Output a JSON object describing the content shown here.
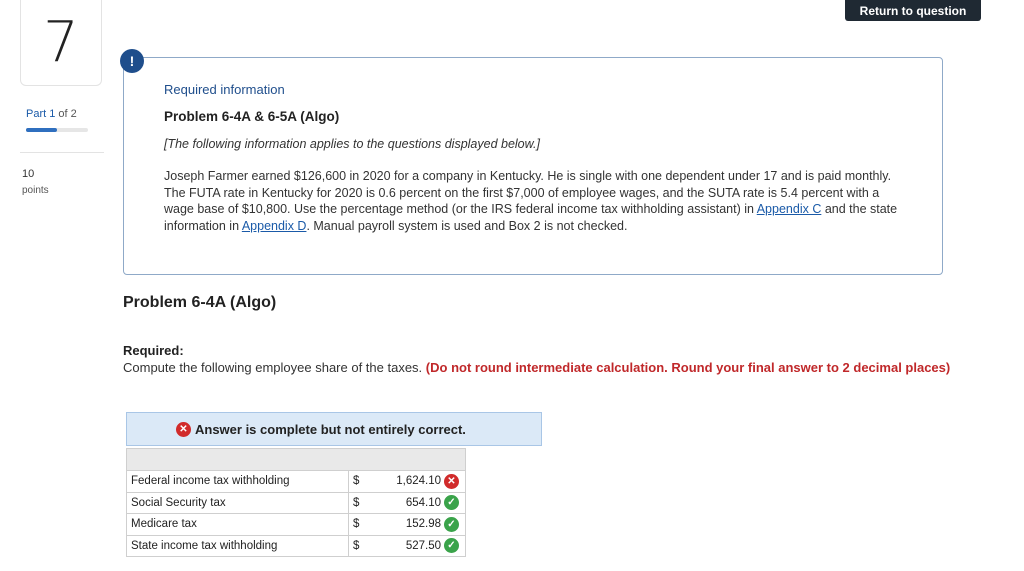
{
  "header": {
    "return_label": "Return to question"
  },
  "question": {
    "number": "7",
    "part_current": "Part 1",
    "part_total": " of 2",
    "progress": 0.5,
    "points_value": "10",
    "points_label": "points"
  },
  "info": {
    "alert_glyph": "!",
    "title": "Required information",
    "problem": "Problem 6-4A & 6-5A (Algo)",
    "note": "[The following information applies to the questions displayed below.]",
    "body_1": "Joseph Farmer earned $126,600 in 2020 for a company in Kentucky. He is single with one dependent under 17 and is paid monthly. The FUTA rate in Kentucky for 2020 is 0.6 percent on the first $7,000 of employee wages, and the SUTA rate is 5.4 percent with a wage base of $10,800. Use the percentage method (or the IRS federal income tax withholding assistant) in ",
    "link_c": "Appendix C",
    "body_2": " and the state information in ",
    "link_d": "Appendix D",
    "body_3": ". Manual payroll system is used and Box 2 is not checked."
  },
  "problem": {
    "title": "Problem 6-4A (Algo)",
    "required_label": "Required:",
    "required_text": "Compute the following employee share of the taxes. ",
    "required_instruction": "(Do not round intermediate calculation. Round your final answer to 2 decimal places)"
  },
  "answer": {
    "banner_icon": "✕",
    "banner_text": "Answer is complete but not entirely correct.",
    "rows": [
      {
        "label": "Federal income tax withholding",
        "currency": "$",
        "value": "1,624.10",
        "status": "incorrect"
      },
      {
        "label": "Social Security tax",
        "currency": "$",
        "value": "654.10",
        "status": "correct"
      },
      {
        "label": "Medicare tax",
        "currency": "$",
        "value": "152.98",
        "status": "correct"
      },
      {
        "label": "State income tax withholding",
        "currency": "$",
        "value": "527.50",
        "status": "correct"
      }
    ]
  },
  "colors": {
    "correct": "#3aa34a",
    "incorrect": "#d12b2b",
    "link": "#1a5aa8",
    "accent": "#1f4e8c"
  }
}
